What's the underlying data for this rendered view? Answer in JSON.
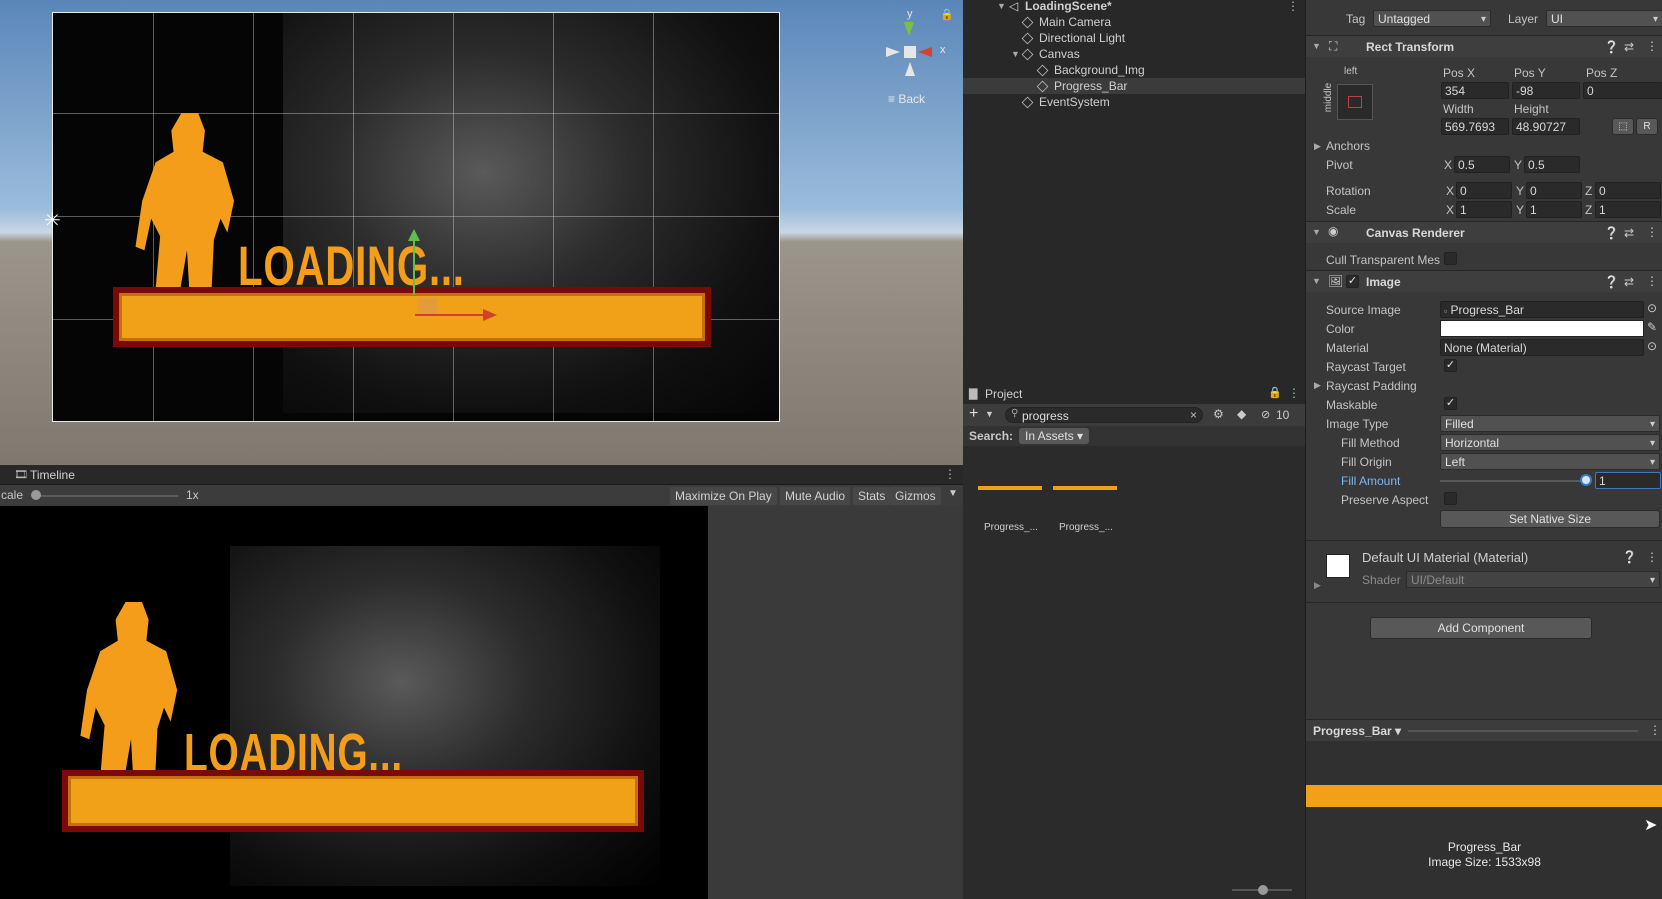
{
  "scene": {
    "gizmo": {
      "y_label": "y",
      "x_label": "x",
      "back_label": "Back"
    },
    "loading_text": "LOADING..."
  },
  "timeline": {
    "title": "Timeline",
    "scale_label": "cale",
    "scale_value": "1x",
    "buttons": [
      "Maximize On Play",
      "Mute Audio",
      "Stats",
      "Gizmos"
    ]
  },
  "game": {
    "loading_text": "LOADING..."
  },
  "hierarchy": {
    "scene_name": "LoadingScene*",
    "items": [
      {
        "label": "Main Camera"
      },
      {
        "label": "Directional Light"
      },
      {
        "label": "Canvas"
      },
      {
        "label": "Background_Img"
      },
      {
        "label": "Progress_Bar"
      },
      {
        "label": "EventSystem"
      }
    ]
  },
  "project": {
    "tab_label": "Project",
    "search_value": "progress",
    "hidden_count": "10",
    "search_label": "Search:",
    "search_scope": "In Assets",
    "assets": [
      {
        "label": "Progress_..."
      },
      {
        "label": "Progress_..."
      }
    ]
  },
  "inspector": {
    "tag_label": "Tag",
    "tag_value": "Untagged",
    "layer_label": "Layer",
    "layer_value": "UI",
    "rect_transform": {
      "title": "Rect Transform",
      "anchor_h": "left",
      "anchor_v": "middle",
      "pos_x_label": "Pos X",
      "pos_x": "354",
      "pos_y_label": "Pos Y",
      "pos_y": "-98",
      "pos_z_label": "Pos Z",
      "pos_z": "0",
      "width_label": "Width",
      "width": "569.7693",
      "height_label": "Height",
      "height": "48.90727",
      "r_btn": "R",
      "anchors_label": "Anchors",
      "pivot_label": "Pivot",
      "pivot_x": "0.5",
      "pivot_y": "0.5",
      "rotation_label": "Rotation",
      "rot_x": "0",
      "rot_y": "0",
      "rot_z": "0",
      "scale_label": "Scale",
      "scale_x": "1",
      "scale_y": "1",
      "scale_z": "1",
      "x": "X",
      "y": "Y",
      "z": "Z"
    },
    "canvas_renderer": {
      "title": "Canvas Renderer",
      "cull_label": "Cull Transparent Mes"
    },
    "image": {
      "title": "Image",
      "source_label": "Source Image",
      "source_value": "Progress_Bar",
      "color_label": "Color",
      "color_value": "#ffffff",
      "material_label": "Material",
      "material_value": "None (Material)",
      "raycast_label": "Raycast Target",
      "raycast_checked": true,
      "raycast_padding_label": "Raycast Padding",
      "maskable_label": "Maskable",
      "maskable_checked": true,
      "image_type_label": "Image Type",
      "image_type_value": "Filled",
      "fill_method_label": "Fill Method",
      "fill_method_value": "Horizontal",
      "fill_origin_label": "Fill Origin",
      "fill_origin_value": "Left",
      "fill_amount_label": "Fill Amount",
      "fill_amount_value": "1",
      "fill_amount_fraction": 1,
      "preserve_label": "Preserve Aspect",
      "native_size_btn": "Set Native Size"
    },
    "material": {
      "title": "Default UI Material (Material)",
      "shader_label": "Shader",
      "shader_value": "UI/Default"
    },
    "add_component": "Add Component",
    "preview": {
      "dropdown": "Progress_Bar",
      "name": "Progress_Bar",
      "size": "Image Size: 1533x98"
    }
  },
  "colors": {
    "accent_orange": "#f39d1a",
    "bar_border": "#7a0a0a",
    "selection": "#3b3b3b"
  }
}
